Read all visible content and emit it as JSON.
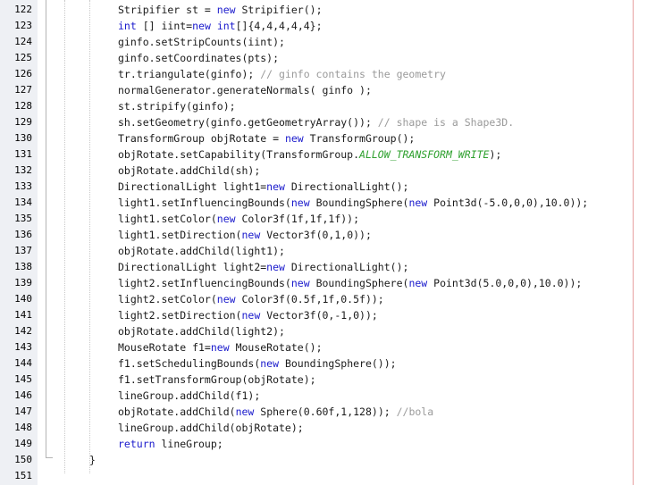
{
  "editor": {
    "lines": [
      {
        "number": "122",
        "indent": 132,
        "tokens": [
          {
            "t": "Stripifier st = ",
            "k": "txt"
          },
          {
            "t": "new",
            "k": "kw"
          },
          {
            "t": " Stripifier();",
            "k": "txt"
          }
        ]
      },
      {
        "number": "123",
        "indent": 132,
        "tokens": [
          {
            "t": "int",
            "k": "kw"
          },
          {
            "t": " [] iint=",
            "k": "txt"
          },
          {
            "t": "new",
            "k": "kw"
          },
          {
            "t": " ",
            "k": "txt"
          },
          {
            "t": "int",
            "k": "kw"
          },
          {
            "t": "[]{4,4,4,4,4};",
            "k": "txt"
          }
        ]
      },
      {
        "number": "124",
        "indent": 132,
        "tokens": [
          {
            "t": "ginfo.setStripCounts(iint);",
            "k": "txt"
          }
        ]
      },
      {
        "number": "125",
        "indent": 132,
        "tokens": [
          {
            "t": "ginfo.setCoordinates(pts);",
            "k": "txt"
          }
        ]
      },
      {
        "number": "126",
        "indent": 132,
        "tokens": [
          {
            "t": "tr.triangulate(ginfo); ",
            "k": "txt"
          },
          {
            "t": "// ginfo contains the geometry",
            "k": "cmt"
          }
        ]
      },
      {
        "number": "127",
        "indent": 132,
        "tokens": [
          {
            "t": "normalGenerator.generateNormals( ginfo );",
            "k": "txt"
          }
        ]
      },
      {
        "number": "128",
        "indent": 132,
        "tokens": [
          {
            "t": "st.stripify(ginfo);",
            "k": "txt"
          }
        ]
      },
      {
        "number": "129",
        "indent": 132,
        "tokens": [
          {
            "t": "sh.setGeometry(ginfo.getGeometryArray()); ",
            "k": "txt"
          },
          {
            "t": "// shape is a Shape3D.",
            "k": "cmt"
          }
        ]
      },
      {
        "number": "130",
        "indent": 132,
        "tokens": [
          {
            "t": "TransformGroup objRotate = ",
            "k": "txt"
          },
          {
            "t": "new",
            "k": "kw"
          },
          {
            "t": " TransformGroup();",
            "k": "txt"
          }
        ]
      },
      {
        "number": "131",
        "indent": 132,
        "tokens": [
          {
            "t": "objRotate.setCapability(TransformGroup.",
            "k": "txt"
          },
          {
            "t": "ALLOW_TRANSFORM_WRITE",
            "k": "const"
          },
          {
            "t": ");",
            "k": "txt"
          }
        ]
      },
      {
        "number": "132",
        "indent": 132,
        "tokens": [
          {
            "t": "objRotate.addChild(sh);",
            "k": "txt"
          }
        ]
      },
      {
        "number": "133",
        "indent": 132,
        "tokens": [
          {
            "t": "DirectionalLight light1=",
            "k": "txt"
          },
          {
            "t": "new",
            "k": "kw"
          },
          {
            "t": " DirectionalLight();",
            "k": "txt"
          }
        ]
      },
      {
        "number": "134",
        "indent": 132,
        "tokens": [
          {
            "t": "light1.setInfluencingBounds(",
            "k": "txt"
          },
          {
            "t": "new",
            "k": "kw"
          },
          {
            "t": " BoundingSphere(",
            "k": "txt"
          },
          {
            "t": "new",
            "k": "kw"
          },
          {
            "t": " Point3d(-5.0,0,0),10.0));",
            "k": "txt"
          }
        ]
      },
      {
        "number": "135",
        "indent": 132,
        "tokens": [
          {
            "t": "light1.setColor(",
            "k": "txt"
          },
          {
            "t": "new",
            "k": "kw"
          },
          {
            "t": " Color3f(1f,1f,1f));",
            "k": "txt"
          }
        ]
      },
      {
        "number": "136",
        "indent": 132,
        "tokens": [
          {
            "t": "light1.setDirection(",
            "k": "txt"
          },
          {
            "t": "new",
            "k": "kw"
          },
          {
            "t": " Vector3f(0,1,0));",
            "k": "txt"
          }
        ]
      },
      {
        "number": "137",
        "indent": 132,
        "tokens": [
          {
            "t": "objRotate.addChild(light1);",
            "k": "txt"
          }
        ]
      },
      {
        "number": "138",
        "indent": 132,
        "tokens": [
          {
            "t": "DirectionalLight light2=",
            "k": "txt"
          },
          {
            "t": "new",
            "k": "kw"
          },
          {
            "t": " DirectionalLight();",
            "k": "txt"
          }
        ]
      },
      {
        "number": "139",
        "indent": 132,
        "tokens": [
          {
            "t": "light2.setInfluencingBounds(",
            "k": "txt"
          },
          {
            "t": "new",
            "k": "kw"
          },
          {
            "t": " BoundingSphere(",
            "k": "txt"
          },
          {
            "t": "new",
            "k": "kw"
          },
          {
            "t": " Point3d(5.0,0,0),10.0));",
            "k": "txt"
          }
        ]
      },
      {
        "number": "140",
        "indent": 132,
        "tokens": [
          {
            "t": "light2.setColor(",
            "k": "txt"
          },
          {
            "t": "new",
            "k": "kw"
          },
          {
            "t": " Color3f(0.5f,1f,0.5f));",
            "k": "txt"
          }
        ]
      },
      {
        "number": "141",
        "indent": 132,
        "tokens": [
          {
            "t": "light2.setDirection(",
            "k": "txt"
          },
          {
            "t": "new",
            "k": "kw"
          },
          {
            "t": " Vector3f(0,-1,0));",
            "k": "txt"
          }
        ]
      },
      {
        "number": "142",
        "indent": 132,
        "tokens": [
          {
            "t": "objRotate.addChild(light2);",
            "k": "txt"
          }
        ]
      },
      {
        "number": "143",
        "indent": 132,
        "tokens": [
          {
            "t": "MouseRotate f1=",
            "k": "txt"
          },
          {
            "t": "new",
            "k": "kw"
          },
          {
            "t": " MouseRotate();",
            "k": "txt"
          }
        ]
      },
      {
        "number": "144",
        "indent": 132,
        "tokens": [
          {
            "t": "f1.setSchedulingBounds(",
            "k": "txt"
          },
          {
            "t": "new",
            "k": "kw"
          },
          {
            "t": " BoundingSphere());",
            "k": "txt"
          }
        ]
      },
      {
        "number": "145",
        "indent": 132,
        "tokens": [
          {
            "t": "f1.setTransformGroup(objRotate);",
            "k": "txt"
          }
        ]
      },
      {
        "number": "146",
        "indent": 132,
        "tokens": [
          {
            "t": "lineGroup.addChild(f1);",
            "k": "txt"
          }
        ]
      },
      {
        "number": "147",
        "indent": 132,
        "tokens": [
          {
            "t": "objRotate.addChild(",
            "k": "txt"
          },
          {
            "t": "new",
            "k": "kw"
          },
          {
            "t": " Sphere(0.60f,1,128)); ",
            "k": "txt"
          },
          {
            "t": "//bola",
            "k": "cmt"
          }
        ]
      },
      {
        "number": "148",
        "indent": 132,
        "tokens": [
          {
            "t": "lineGroup.addChild(objRotate);",
            "k": "txt"
          }
        ]
      },
      {
        "number": "149",
        "indent": 132,
        "tokens": [
          {
            "t": "return",
            "k": "kw"
          },
          {
            "t": " lineGroup;",
            "k": "txt"
          }
        ]
      },
      {
        "number": "150",
        "indent": 100,
        "tokens": [
          {
            "t": "}",
            "k": "txt"
          }
        ]
      },
      {
        "number": "151",
        "indent": 132,
        "tokens": []
      }
    ]
  }
}
